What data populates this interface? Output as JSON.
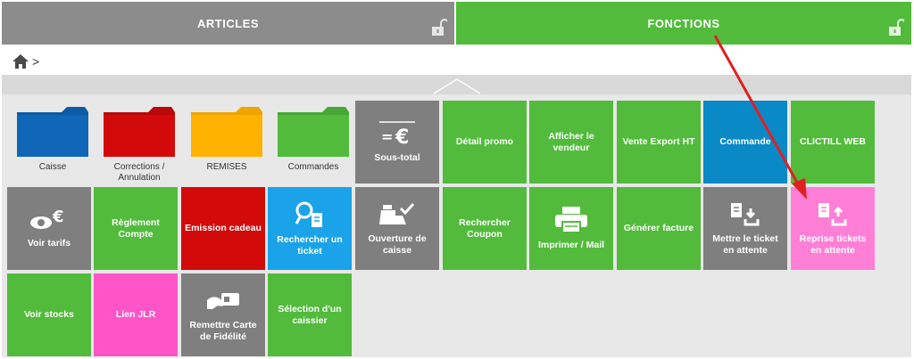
{
  "tabs": {
    "articles": "ARTICLES",
    "fonctions": "FONCTIONS"
  },
  "breadcrumb": {
    "separator": ">"
  },
  "tiles": {
    "caisse": "Caisse",
    "corrections": "Corrections / Annulation",
    "remises": "REMISES",
    "commandes": "Commandes",
    "sous_total": "Sous-total",
    "detail_promo": "Détail promo",
    "afficher_vendeur": "Afficher le vendeur",
    "vente_export": "Vente Export HT",
    "commande": "Commande",
    "clictill_web": "CLICTILL WEB",
    "voir_tarifs": "Voir tarifs",
    "reglement_compte": "Règlement Compte",
    "emission_cadeau": "Emission cadeau",
    "rechercher_ticket": "Rechercher un ticket",
    "ouverture_caisse": "Ouverture de caisse",
    "rechercher_coupon": "Rechercher Coupon",
    "imprimer_mail": "Imprimer / Mail",
    "generer_facture": "Générer facture",
    "mettre_ticket_attente": "Mettre le ticket en attente",
    "reprise_tickets": "Reprise tickets en attente",
    "voir_stocks": "Voir stocks",
    "lien_jlr": "Lien JLR",
    "remettre_carte": "Remettre Carte de Fidélité",
    "selection_caissier": "Sélection d'un caissier"
  },
  "colors": {
    "gray": "#7f7f7f",
    "green": "#52bb3c",
    "blue": "#0a89c7",
    "cyan": "#1aa3e8",
    "red": "#d30a0a",
    "pink": "#ff7fd6",
    "magenta": "#ff55c8",
    "annotation_arrow": "#e02020"
  },
  "icons": {
    "lock": "unlocked-padlock-icon",
    "home": "home-icon",
    "caret": "chevron-up-icon"
  }
}
